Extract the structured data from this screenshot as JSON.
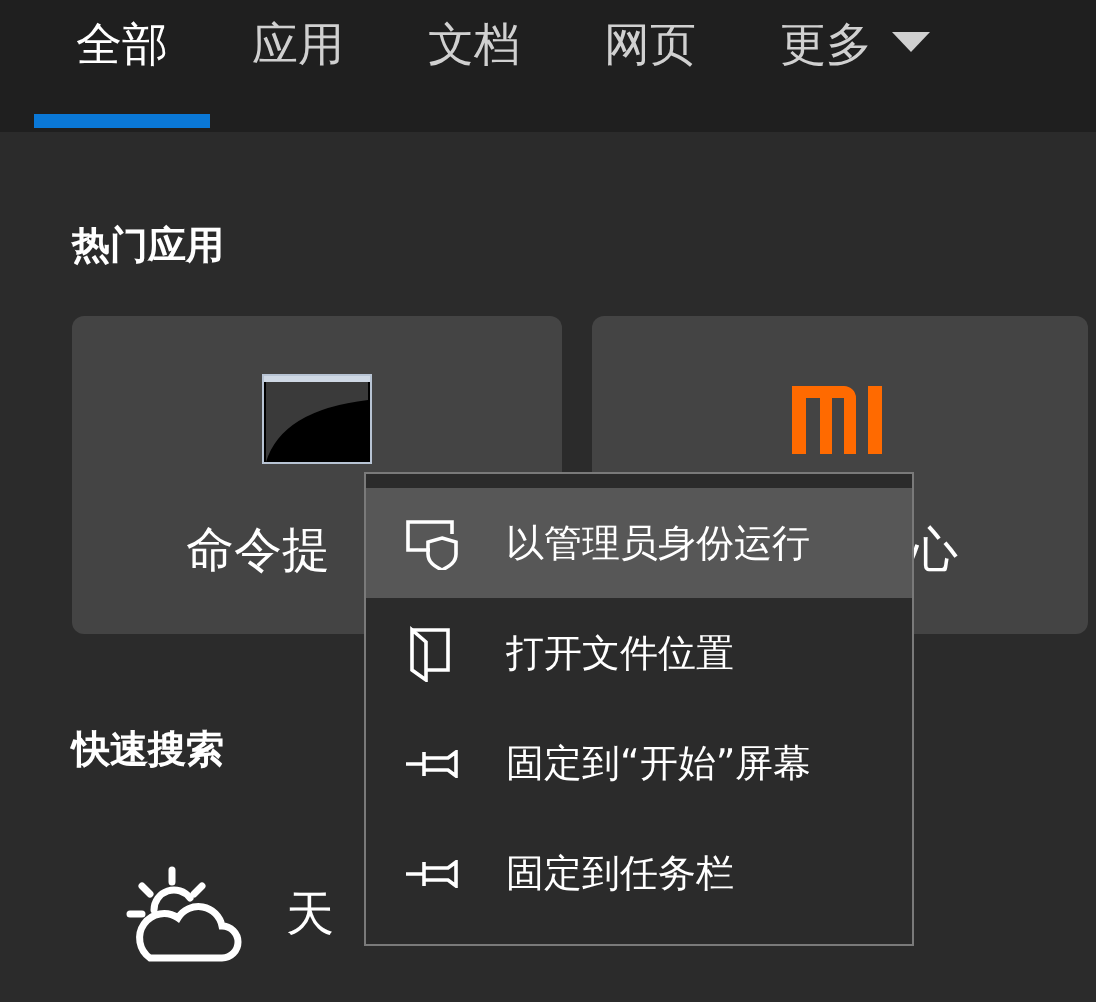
{
  "tabs": [
    {
      "label": "全部",
      "selected": true
    },
    {
      "label": "应用",
      "selected": false
    },
    {
      "label": "文档",
      "selected": false
    },
    {
      "label": "网页",
      "selected": false
    },
    {
      "label": "更多",
      "selected": false,
      "dropdown": true
    }
  ],
  "hot_apps": {
    "title": "热门应用",
    "cards": [
      {
        "kind": "terminal",
        "label": "命令提"
      },
      {
        "kind": "mi",
        "label": "心"
      }
    ]
  },
  "quick_search": {
    "title": "快速搜索",
    "items": [
      {
        "kind": "weather",
        "label": "天"
      }
    ]
  },
  "context_menu": {
    "items": [
      {
        "kind": "shield",
        "label": "以管理员身份运行",
        "selected": true
      },
      {
        "kind": "folder",
        "label": "打开文件位置",
        "selected": false
      },
      {
        "kind": "pin",
        "label": "固定到“开始”屏幕",
        "selected": false
      },
      {
        "kind": "pin",
        "label": "固定到任务栏",
        "selected": false
      }
    ]
  }
}
